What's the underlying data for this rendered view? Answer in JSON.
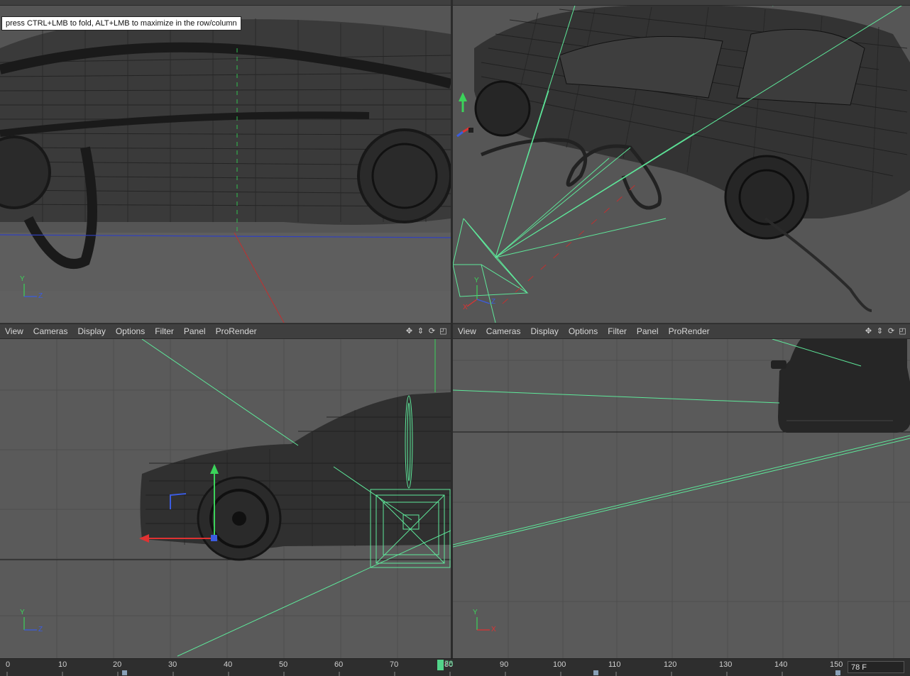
{
  "tooltip": "press CTRL+LMB to fold, ALT+LMB to maximize in the row/column",
  "menu": [
    "View",
    "Cameras",
    "Display",
    "Options",
    "Filter",
    "Panel",
    "ProRender"
  ],
  "viewports": {
    "top_left": {
      "axis_v": "Y",
      "axis_h": "Z"
    },
    "top_right": {
      "axis_v": "Y",
      "axis_h": "X",
      "axis_d": "Z"
    },
    "bottom_left": {
      "axis_v": "Y",
      "axis_h": "Z"
    },
    "bottom_right": {
      "axis_v": "Y",
      "axis_h": "X"
    }
  },
  "viewport_icons": [
    "move-icon",
    "scroll-icon",
    "rotate-icon",
    "maximize-icon"
  ],
  "timeline": {
    "ticks": [
      "0",
      "10",
      "20",
      "30",
      "40",
      "50",
      "60",
      "70",
      "80",
      "90",
      "100",
      "110",
      "120",
      "130",
      "140",
      "150"
    ],
    "current_marker": "78",
    "current_frame_field": "78 F",
    "current_frame": 78
  },
  "colors": {
    "viewport_bg": "#5a5a5a",
    "wire": "#1c1c1c",
    "selection": "#5ee89a",
    "axis_x": "#e03232",
    "axis_y": "#3bd35a",
    "axis_z": "#3b5ce0"
  }
}
